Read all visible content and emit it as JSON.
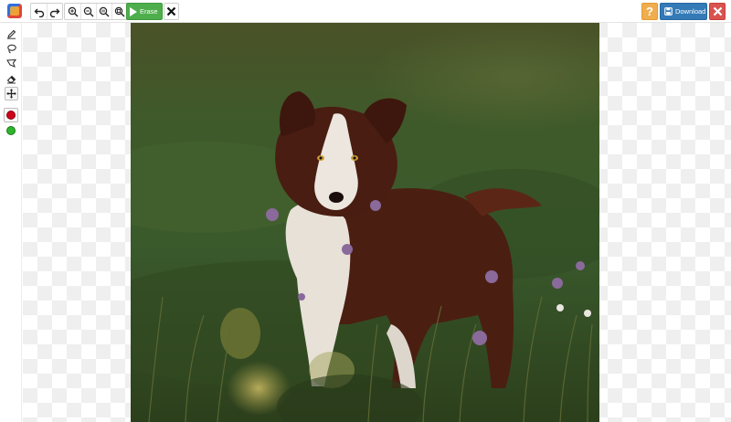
{
  "toolbar": {
    "history": [
      {
        "name": "undo-button",
        "icon": "undo-icon"
      },
      {
        "name": "redo-button",
        "icon": "redo-icon"
      }
    ],
    "zoom": [
      {
        "name": "zoom-in-button",
        "icon": "zoom-in-icon"
      },
      {
        "name": "zoom-out-button",
        "icon": "zoom-out-icon"
      },
      {
        "name": "zoom-actual-button",
        "icon": "zoom-actual-icon"
      },
      {
        "name": "zoom-fit-button",
        "icon": "zoom-fit-icon"
      }
    ],
    "erase_label": "Erase",
    "download_label": "Download",
    "help_label": "?"
  },
  "tools": [
    {
      "name": "brush-tool",
      "icon": "pencil-icon"
    },
    {
      "name": "lasso-tool",
      "icon": "lasso-icon"
    },
    {
      "name": "polygon-lasso-tool",
      "icon": "polygon-lasso-icon"
    },
    {
      "name": "eraser-tool",
      "icon": "eraser-icon"
    },
    {
      "name": "move-tool",
      "icon": "move-icon",
      "active": true
    }
  ],
  "colors": {
    "remove_marker": "#d0021b",
    "keep_marker": "#2db52d",
    "erase_button": "#4fae4c",
    "download_button": "#337ab7",
    "help_button": "#f0ad4e",
    "exit_button": "#d9534f"
  },
  "image": {
    "subject": "dog-photo"
  }
}
